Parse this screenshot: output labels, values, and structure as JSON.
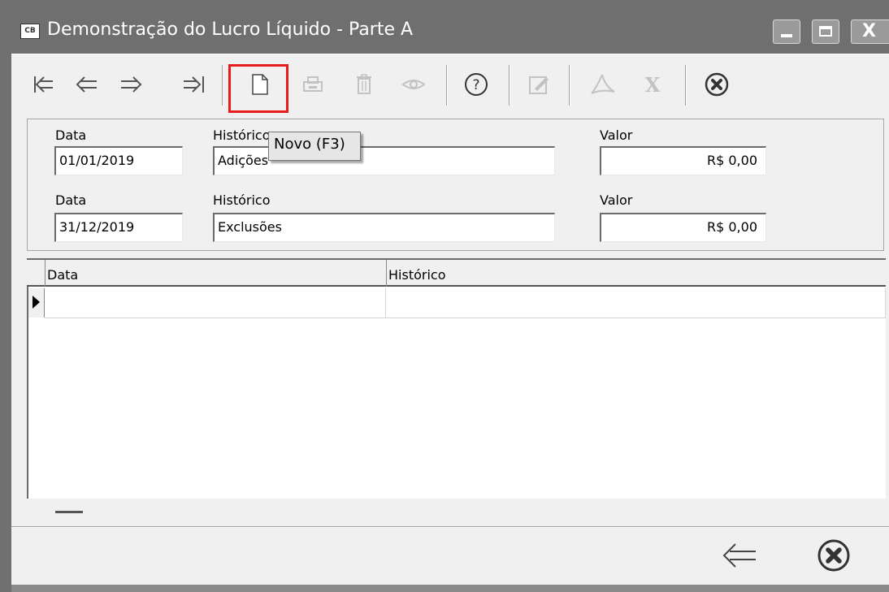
{
  "window": {
    "title": "Demonstração do Lucro Líquido - Parte A",
    "app_icon_text": "CB"
  },
  "toolbar": {
    "tooltip": "Novo (F3)",
    "buttons": [
      "first-record",
      "previous-record",
      "next-record",
      "last-record",
      "new-document",
      "print",
      "delete",
      "view",
      "help",
      "edit",
      "pdf",
      "excel",
      "close"
    ]
  },
  "form": {
    "row1": {
      "data_label": "Data",
      "data_value": "01/01/2019",
      "historico_label": "Histórico",
      "historico_value": "Adições",
      "valor_label": "Valor",
      "valor_value": "R$ 0,00"
    },
    "row2": {
      "data_label": "Data",
      "data_value": "31/12/2019",
      "historico_label": "Histórico",
      "historico_value": "Exclusões",
      "valor_label": "Valor",
      "valor_value": "R$ 0,00"
    }
  },
  "grid": {
    "columns": [
      "Data",
      "Histórico"
    ],
    "rows": [
      [
        "",
        ""
      ]
    ]
  },
  "colors": {
    "highlight": "#e81c1c",
    "titlebar": "#6f6f6f",
    "client": "#f0f0f0"
  }
}
